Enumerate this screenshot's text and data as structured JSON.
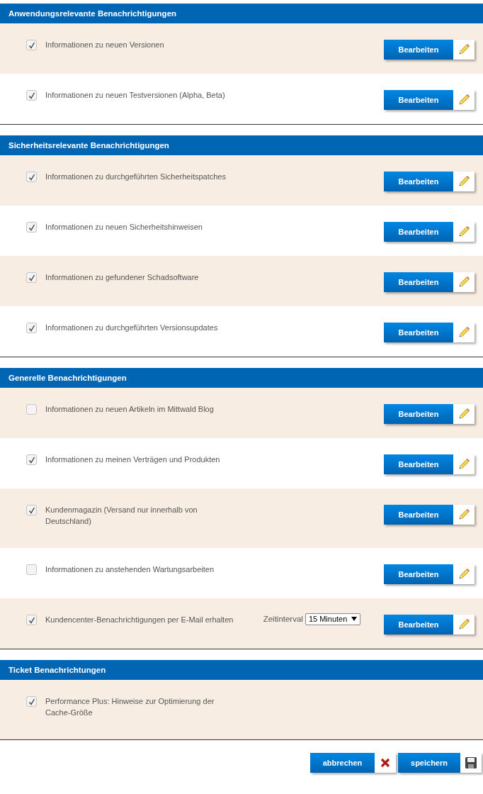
{
  "sections": [
    {
      "title": "Anwendungsrelevante Benachrichtigungen",
      "items": [
        {
          "kind": "plain",
          "checked": true,
          "label": "Informationen zu neuen Versionen",
          "button": "Bearbeiten"
        },
        {
          "kind": "plain",
          "checked": true,
          "label": "Informationen zu neuen Testversionen (Alpha, Beta)",
          "button": "Bearbeiten"
        }
      ]
    },
    {
      "title": "Sicherheitsrelevante Benachrichtigungen",
      "items": [
        {
          "kind": "plain",
          "checked": true,
          "label": "Informationen zu durchgeführten Sicherheitspatches",
          "button": "Bearbeiten"
        },
        {
          "kind": "plain",
          "checked": true,
          "label": "Informationen zu neuen Sicherheitshinweisen",
          "button": "Bearbeiten"
        },
        {
          "kind": "plain",
          "checked": true,
          "label": "Informationen zu gefundener Schadsoftware",
          "button": "Bearbeiten"
        },
        {
          "kind": "plain",
          "checked": true,
          "label": "Informationen zu durchgeführten Versionsupdates",
          "button": "Bearbeiten"
        }
      ]
    },
    {
      "title": "Generelle Benachrichtigungen",
      "items": [
        {
          "kind": "plain",
          "checked": false,
          "label": "Informationen zu neuen Artikeln im Mittwald Blog",
          "button": "Bearbeiten"
        },
        {
          "kind": "plain",
          "checked": true,
          "label": "Informationen zu meinen Verträgen und Produkten",
          "button": "Bearbeiten"
        },
        {
          "kind": "plain",
          "checked": true,
          "label": "Kundenmagazin (Versand nur innerhalb von Deutschland)",
          "button": "Bearbeiten"
        },
        {
          "kind": "plain",
          "checked": false,
          "label": "Informationen zu anstehenden Wartungsarbeiten",
          "button": "Bearbeiten"
        },
        {
          "kind": "interval",
          "checked": true,
          "label": "Kundencenter-Benachrichtigungen per E-Mail erhalten",
          "interval_label": "Zeitinterval",
          "interval_value": "15 Minuten",
          "button": "Bearbeiten"
        }
      ]
    },
    {
      "title": "Ticket Benachrichtungen",
      "items": [
        {
          "kind": "plain",
          "checked": true,
          "label": "Performance Plus: Hinweise zur Optimierung der Cache-Größe"
        }
      ]
    }
  ],
  "footer": {
    "cancel": "abbrechen",
    "save": "speichern"
  }
}
